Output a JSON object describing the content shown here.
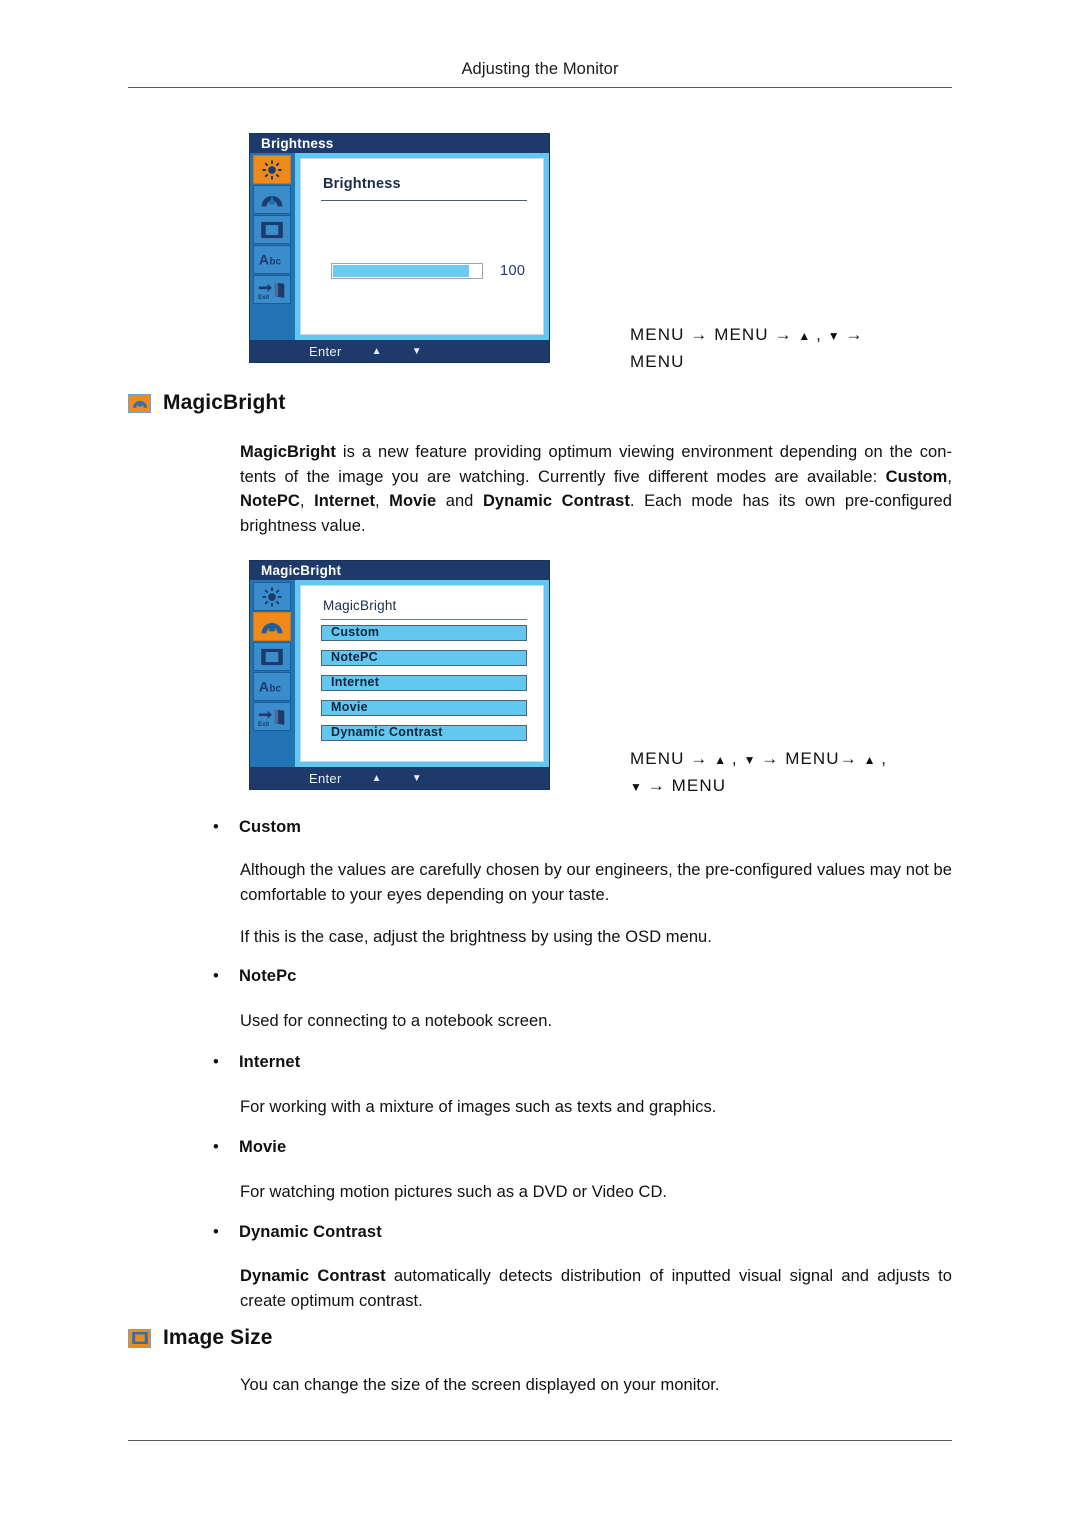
{
  "header": {
    "title": "Adjusting the Monitor"
  },
  "osd_brightness": {
    "title": "Brightness",
    "heading": "Brightness",
    "slider_value": "100",
    "slider_percent": 92,
    "footer": {
      "enter": "Enter",
      "up_arrow": "▲",
      "down_arrow": "▼"
    },
    "rail_icons": [
      {
        "name": "brightness-sun-icon",
        "active": true
      },
      {
        "name": "magicbright-gauge-icon",
        "active": false
      },
      {
        "name": "image-size-icon",
        "active": false
      },
      {
        "name": "osd-text-abc-icon",
        "active": false
      },
      {
        "name": "exit-door-icon",
        "active": false
      }
    ]
  },
  "nav_hint_brightness": {
    "line1_pre": "MENU → MENU → ",
    "line1_up": "▲",
    "line1_mid": " , ",
    "line1_down": "▼",
    "line1_post": " →",
    "line2": "MENU"
  },
  "section_magicbright": {
    "icon": "magicbright-gauge-icon",
    "title": "MagicBright"
  },
  "intro_paragraph": {
    "b1": "MagicBright",
    "t1": " is a new feature providing optimum viewing environment depending on the con-tents of the image you are watching. Currently five different modes are available: ",
    "b2": "Custom",
    "t2": ", ",
    "b3": "NotePC",
    "t3": ", ",
    "b4": "Internet",
    "t4": ", ",
    "b5": "Movie",
    "t5": " and ",
    "b6": "Dynamic Contrast",
    "t6": ". Each mode has its own pre-configured brightness value."
  },
  "osd_magicbright": {
    "title": "MagicBright",
    "heading": "MagicBright",
    "items": [
      {
        "label": "Custom"
      },
      {
        "label": "NotePC"
      },
      {
        "label": "Internet"
      },
      {
        "label": "Movie"
      },
      {
        "label": "Dynamic Contrast"
      }
    ],
    "footer": {
      "enter": "Enter",
      "up_arrow": "▲",
      "down_arrow": "▼"
    },
    "rail_icons": [
      {
        "name": "brightness-sun-icon",
        "active": false
      },
      {
        "name": "magicbright-gauge-icon",
        "active": true
      },
      {
        "name": "image-size-icon",
        "active": false
      },
      {
        "name": "osd-text-abc-icon",
        "active": false
      },
      {
        "name": "exit-door-icon",
        "active": false
      }
    ]
  },
  "nav_hint_magicbright": {
    "line1_pre": "MENU → ",
    "line1_up": "▲",
    "line1_mid": " , ",
    "line1_down": "▼",
    "line1_post2": " → MENU→ ",
    "line1_up2": "▲",
    "line1_end": " ,",
    "line2_down": "▼",
    "line2_rest": " → MENU"
  },
  "modes": [
    {
      "bullet": "Custom",
      "body1": "Although the values are carefully chosen by our engineers, the pre-configured values may not be comfortable to your eyes depending on your taste.",
      "body2": "If this is the case, adjust the brightness by using the OSD menu."
    },
    {
      "bullet": "NotePc",
      "body1": "Used for connecting to a notebook screen."
    },
    {
      "bullet": "Internet",
      "body1": "For working with a mixture of images such as texts and graphics."
    },
    {
      "bullet": "Movie",
      "body1": "For watching motion pictures such as a DVD or Video CD."
    },
    {
      "bullet": "Dynamic Contrast",
      "body_bold": "Dynamic Contrast",
      "body_rest": " automatically detects distribution of inputted visual signal and adjusts to create optimum contrast."
    }
  ],
  "section_image_size": {
    "icon": "image-size-icon",
    "title": "Image Size",
    "body": "You can change the size of the screen displayed on your monitor."
  },
  "colors": {
    "osd_frame": "#1d3a6b",
    "osd_rail": "#2274b5",
    "osd_accent_orange": "#f08a1b",
    "osd_screen_border": "#62c8f0",
    "slider_fill": "#6ec9f2"
  },
  "bullet_char": "•"
}
